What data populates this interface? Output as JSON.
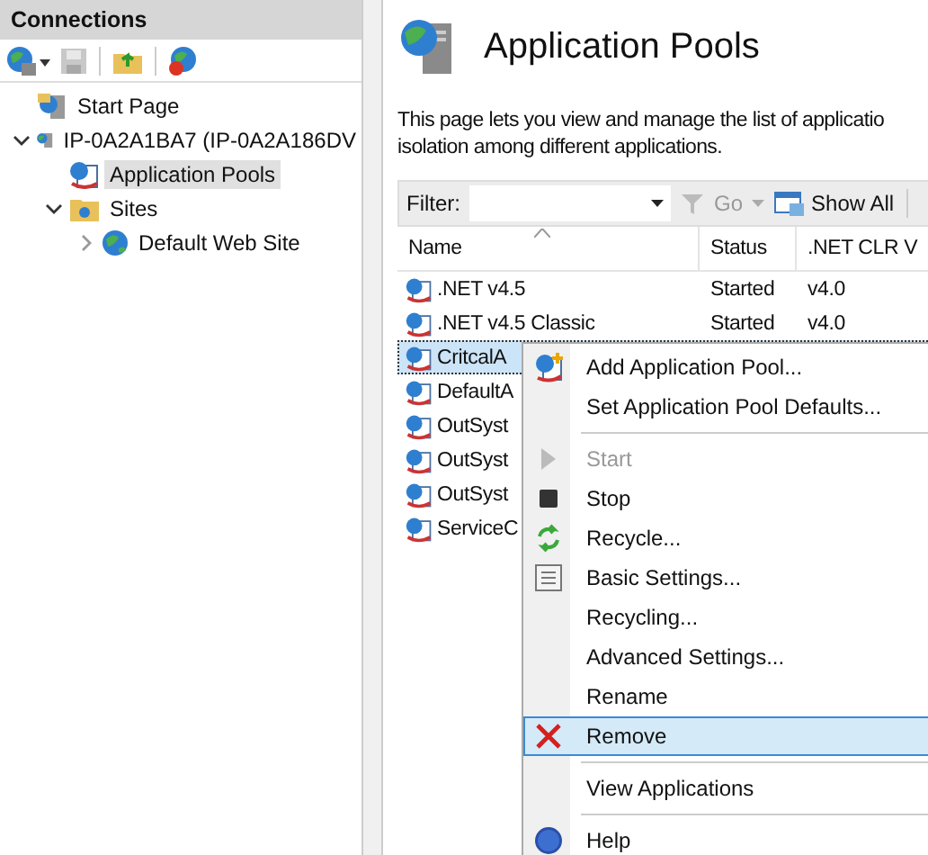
{
  "connections": {
    "title": "Connections",
    "tree": [
      {
        "kind": "start",
        "label": "Start Page",
        "selected": false
      },
      {
        "kind": "server",
        "label": "IP-0A2A1BA7 (IP-0A2A186DV",
        "expanded": true,
        "selected": false,
        "children": [
          {
            "kind": "pools",
            "label": "Application Pools",
            "selected": true
          },
          {
            "kind": "folder",
            "label": "Sites",
            "expanded": true,
            "selected": false,
            "children": [
              {
                "kind": "site",
                "label": "Default Web Site",
                "expanded": false,
                "selected": false
              }
            ]
          }
        ]
      }
    ]
  },
  "page": {
    "title": "Application Pools",
    "description": [
      "This page lets you view and manage the list of applicatio",
      "isolation among different applications."
    ],
    "filter": {
      "label": "Filter:",
      "go": "Go",
      "show_all": "Show All"
    },
    "columns": [
      "Name",
      "Status",
      ".NET CLR V"
    ],
    "rows": [
      {
        "name": ".NET v4.5",
        "status": "Started",
        "clr": "v4.0",
        "selected": false
      },
      {
        "name": ".NET v4.5 Classic",
        "status": "Started",
        "clr": "v4.0",
        "selected": false
      },
      {
        "name": "CritcalA",
        "selected": true
      },
      {
        "name": "DefaultA",
        "selected": false
      },
      {
        "name": "OutSyst",
        "selected": false
      },
      {
        "name": "OutSyst",
        "selected": false
      },
      {
        "name": "OutSyst",
        "selected": false
      },
      {
        "name": "ServiceC",
        "selected": false
      }
    ]
  },
  "context_menu": [
    {
      "kind": "item",
      "label": "Add Application Pool...",
      "disabled": false,
      "selected": false
    },
    {
      "kind": "item",
      "label": "Set Application Pool Defaults...",
      "disabled": false,
      "selected": false
    },
    {
      "kind": "separator"
    },
    {
      "kind": "item",
      "label": "Start",
      "disabled": true,
      "selected": false
    },
    {
      "kind": "item",
      "label": "Stop",
      "disabled": false,
      "selected": false
    },
    {
      "kind": "item",
      "label": "Recycle...",
      "disabled": false,
      "selected": false
    },
    {
      "kind": "item",
      "label": "Basic Settings...",
      "disabled": false,
      "selected": false
    },
    {
      "kind": "item",
      "label": "Recycling...",
      "disabled": false,
      "selected": false
    },
    {
      "kind": "item",
      "label": "Advanced Settings...",
      "disabled": false,
      "selected": false
    },
    {
      "kind": "item",
      "label": "Rename",
      "disabled": false,
      "selected": false
    },
    {
      "kind": "item",
      "label": "Remove",
      "disabled": false,
      "selected": true
    },
    {
      "kind": "separator"
    },
    {
      "kind": "item",
      "label": "View Applications",
      "disabled": false,
      "selected": false
    },
    {
      "kind": "separator"
    },
    {
      "kind": "item",
      "label": "Help",
      "disabled": false,
      "selected": false
    }
  ]
}
